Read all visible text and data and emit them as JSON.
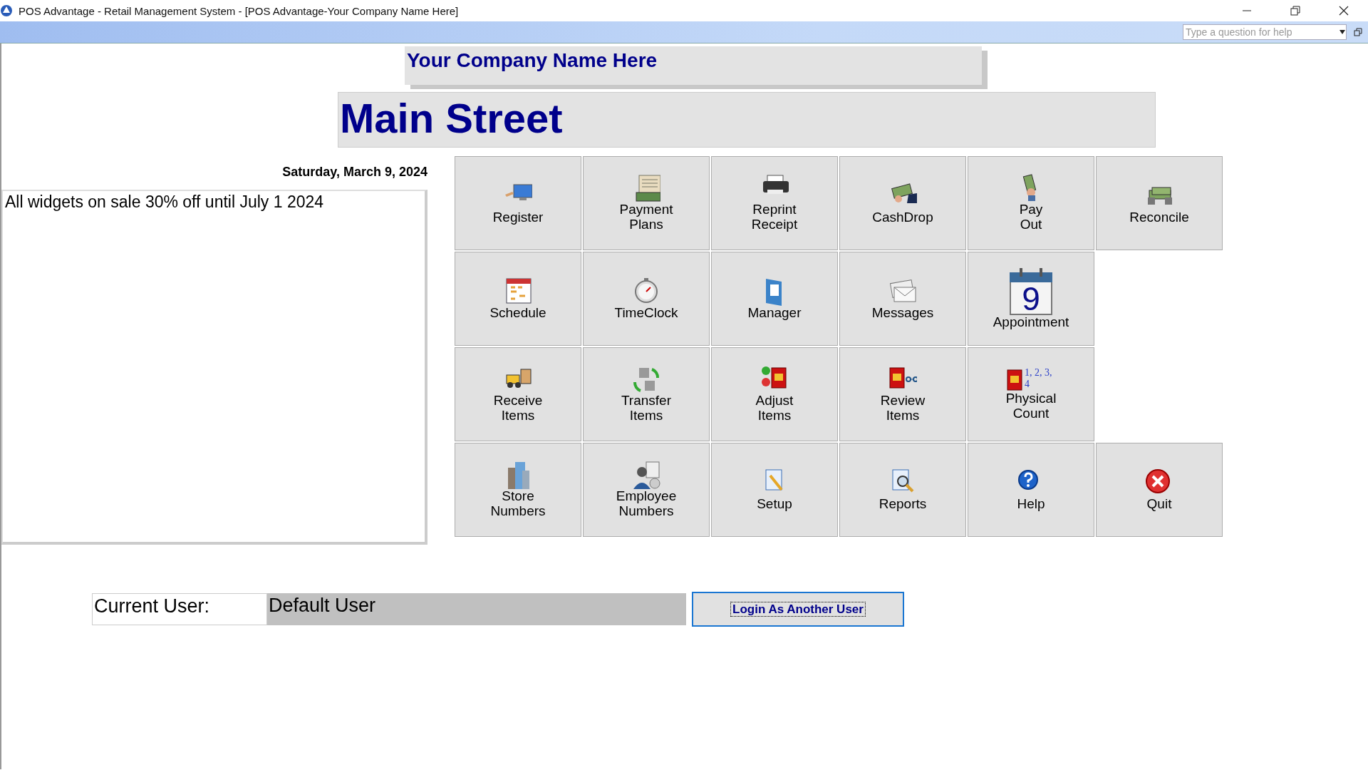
{
  "window": {
    "title": "POS Advantage - Retail Management System - [POS Advantage-Your Company Name Here]"
  },
  "help_box": {
    "placeholder": "Type a question for help"
  },
  "company_name": "Your Company Name Here",
  "store_name": "Main Street",
  "date": "Saturday, March 9, 2024",
  "message": "All widgets on sale 30% off until July 1 2024",
  "tiles": [
    [
      {
        "label": "Register"
      },
      {
        "label": "Payment Plans"
      },
      {
        "label": "Reprint Receipt"
      },
      {
        "label": "CashDrop"
      },
      {
        "label": "Pay Out"
      },
      {
        "label": "Reconcile"
      }
    ],
    [
      {
        "label": "Schedule"
      },
      {
        "label": "TimeClock"
      },
      {
        "label": "Manager"
      },
      {
        "label": "Messages"
      },
      {
        "label": "Appointment",
        "icon_text": "9"
      }
    ],
    [
      {
        "label": "Receive Items"
      },
      {
        "label": "Transfer Items"
      },
      {
        "label": "Adjust Items"
      },
      {
        "label": "Review Items"
      },
      {
        "label": "Physical Count",
        "icon_text": "1, 2, 3, 4"
      }
    ],
    [
      {
        "label": "Store Numbers"
      },
      {
        "label": "Employee Numbers"
      },
      {
        "label": "Setup"
      },
      {
        "label": "Reports"
      },
      {
        "label": "Help"
      },
      {
        "label": "Quit"
      }
    ]
  ],
  "user": {
    "label": "Current User:",
    "value": "Default User"
  },
  "login_button": "Login As Another User"
}
